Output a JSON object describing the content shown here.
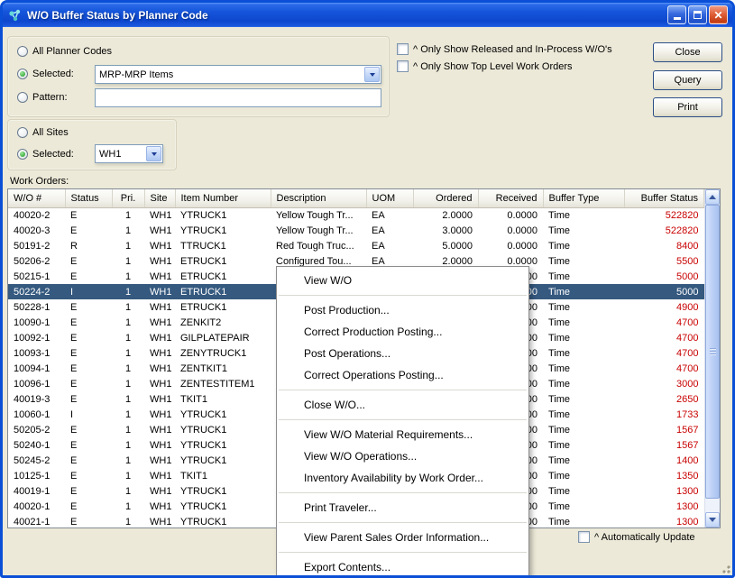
{
  "window": {
    "title": "W/O Buffer Status by Planner Code"
  },
  "planner_group": {
    "all_label": "All Planner Codes",
    "selected_label": "Selected:",
    "selected_value": "MRP-MRP Items",
    "pattern_label": "Pattern:",
    "pattern_value": "",
    "choice": "selected"
  },
  "filters": {
    "released_label": "^ Only Show Released and In-Process W/O's",
    "released_checked": false,
    "toplevel_label": "^ Only Show Top Level Work Orders",
    "toplevel_checked": false
  },
  "actions": {
    "close": "Close",
    "query": "Query",
    "print": "Print"
  },
  "sites_group": {
    "all_label": "All Sites",
    "selected_label": "Selected:",
    "selected_value": "WH1",
    "choice": "selected"
  },
  "work_orders": {
    "label": "Work Orders:",
    "columns": [
      {
        "key": "wo",
        "label": "W/O #",
        "align": "left"
      },
      {
        "key": "status",
        "label": "Status",
        "align": "left"
      },
      {
        "key": "pri",
        "label": "Pri.",
        "align": "center"
      },
      {
        "key": "site",
        "label": "Site",
        "align": "left"
      },
      {
        "key": "item",
        "label": "Item Number",
        "align": "left"
      },
      {
        "key": "desc",
        "label": "Description",
        "align": "left"
      },
      {
        "key": "uom",
        "label": "UOM",
        "align": "left"
      },
      {
        "key": "ordered",
        "label": "Ordered",
        "align": "right"
      },
      {
        "key": "received",
        "label": "Received",
        "align": "right"
      },
      {
        "key": "buffer_type",
        "label": "Buffer Type",
        "align": "left"
      },
      {
        "key": "buffer_status",
        "label": "Buffer Status",
        "align": "right"
      }
    ],
    "rows": [
      {
        "wo": "40020-2",
        "status": "E",
        "pri": "1",
        "site": "WH1",
        "item": "YTRUCK1",
        "desc": "Yellow Tough Tr...",
        "uom": "EA",
        "ordered": "2.0000",
        "received": "0.0000",
        "buffer_type": "Time",
        "buffer_status": "522820",
        "selected": false
      },
      {
        "wo": "40020-3",
        "status": "E",
        "pri": "1",
        "site": "WH1",
        "item": "YTRUCK1",
        "desc": "Yellow Tough Tr...",
        "uom": "EA",
        "ordered": "3.0000",
        "received": "0.0000",
        "buffer_type": "Time",
        "buffer_status": "522820",
        "selected": false
      },
      {
        "wo": "50191-2",
        "status": "R",
        "pri": "1",
        "site": "WH1",
        "item": "TTRUCK1",
        "desc": "Red Tough Truc...",
        "uom": "EA",
        "ordered": "5.0000",
        "received": "0.0000",
        "buffer_type": "Time",
        "buffer_status": "8400",
        "selected": false
      },
      {
        "wo": "50206-2",
        "status": "E",
        "pri": "1",
        "site": "WH1",
        "item": "ETRUCK1",
        "desc": "Configured Tou...",
        "uom": "EA",
        "ordered": "2.0000",
        "received": "0.0000",
        "buffer_type": "Time",
        "buffer_status": "5500",
        "selected": false
      },
      {
        "wo": "50215-1",
        "status": "E",
        "pri": "1",
        "site": "WH1",
        "item": "ETRUCK1",
        "desc": "",
        "uom": "",
        "ordered": "",
        "received": "0.0000",
        "buffer_type": "Time",
        "buffer_status": "5000",
        "selected": false
      },
      {
        "wo": "50224-2",
        "status": "I",
        "pri": "1",
        "site": "WH1",
        "item": "ETRUCK1",
        "desc": "",
        "uom": "",
        "ordered": "",
        "received": "0.0000",
        "buffer_type": "Time",
        "buffer_status": "5000",
        "selected": true
      },
      {
        "wo": "50228-1",
        "status": "E",
        "pri": "1",
        "site": "WH1",
        "item": "ETRUCK1",
        "desc": "",
        "uom": "",
        "ordered": "",
        "received": "0.0000",
        "buffer_type": "Time",
        "buffer_status": "4900",
        "selected": false
      },
      {
        "wo": "10090-1",
        "status": "E",
        "pri": "1",
        "site": "WH1",
        "item": "ZENKIT2",
        "desc": "",
        "uom": "",
        "ordered": "",
        "received": "0.0000",
        "buffer_type": "Time",
        "buffer_status": "4700",
        "selected": false
      },
      {
        "wo": "10092-1",
        "status": "E",
        "pri": "1",
        "site": "WH1",
        "item": "GILPLATEPAIR",
        "desc": "",
        "uom": "",
        "ordered": "",
        "received": "0.0000",
        "buffer_type": "Time",
        "buffer_status": "4700",
        "selected": false
      },
      {
        "wo": "10093-1",
        "status": "E",
        "pri": "1",
        "site": "WH1",
        "item": "ZENYTRUCK1",
        "desc": "",
        "uom": "",
        "ordered": "",
        "received": "0.0000",
        "buffer_type": "Time",
        "buffer_status": "4700",
        "selected": false
      },
      {
        "wo": "10094-1",
        "status": "E",
        "pri": "1",
        "site": "WH1",
        "item": "ZENTKIT1",
        "desc": "",
        "uom": "",
        "ordered": "",
        "received": "0.0000",
        "buffer_type": "Time",
        "buffer_status": "4700",
        "selected": false
      },
      {
        "wo": "10096-1",
        "status": "E",
        "pri": "1",
        "site": "WH1",
        "item": "ZENTESTITEM1",
        "desc": "",
        "uom": "",
        "ordered": "",
        "received": "0.0000",
        "buffer_type": "Time",
        "buffer_status": "3000",
        "selected": false
      },
      {
        "wo": "40019-3",
        "status": "E",
        "pri": "1",
        "site": "WH1",
        "item": "TKIT1",
        "desc": "",
        "uom": "",
        "ordered": "",
        "received": "0.0000",
        "buffer_type": "Time",
        "buffer_status": "2650",
        "selected": false
      },
      {
        "wo": "10060-1",
        "status": "I",
        "pri": "1",
        "site": "WH1",
        "item": "YTRUCK1",
        "desc": "",
        "uom": "",
        "ordered": "",
        "received": "0.0000",
        "buffer_type": "Time",
        "buffer_status": "1733",
        "selected": false
      },
      {
        "wo": "50205-2",
        "status": "E",
        "pri": "1",
        "site": "WH1",
        "item": "YTRUCK1",
        "desc": "",
        "uom": "",
        "ordered": "",
        "received": "0.0000",
        "buffer_type": "Time",
        "buffer_status": "1567",
        "selected": false
      },
      {
        "wo": "50240-1",
        "status": "E",
        "pri": "1",
        "site": "WH1",
        "item": "YTRUCK1",
        "desc": "",
        "uom": "",
        "ordered": "",
        "received": "0.0000",
        "buffer_type": "Time",
        "buffer_status": "1567",
        "selected": false
      },
      {
        "wo": "50245-2",
        "status": "E",
        "pri": "1",
        "site": "WH1",
        "item": "YTRUCK1",
        "desc": "",
        "uom": "",
        "ordered": "",
        "received": "0.0000",
        "buffer_type": "Time",
        "buffer_status": "1400",
        "selected": false
      },
      {
        "wo": "10125-1",
        "status": "E",
        "pri": "1",
        "site": "WH1",
        "item": "TKIT1",
        "desc": "",
        "uom": "",
        "ordered": "",
        "received": "0.0000",
        "buffer_type": "Time",
        "buffer_status": "1350",
        "selected": false
      },
      {
        "wo": "40019-1",
        "status": "E",
        "pri": "1",
        "site": "WH1",
        "item": "YTRUCK1",
        "desc": "",
        "uom": "",
        "ordered": "",
        "received": "0.0000",
        "buffer_type": "Time",
        "buffer_status": "1300",
        "selected": false
      },
      {
        "wo": "40020-1",
        "status": "E",
        "pri": "1",
        "site": "WH1",
        "item": "YTRUCK1",
        "desc": "",
        "uom": "",
        "ordered": "",
        "received": "0.0000",
        "buffer_type": "Time",
        "buffer_status": "1300",
        "selected": false
      },
      {
        "wo": "40021-1",
        "status": "E",
        "pri": "1",
        "site": "WH1",
        "item": "YTRUCK1",
        "desc": "",
        "uom": "",
        "ordered": "",
        "received": "0.0000",
        "buffer_type": "Time",
        "buffer_status": "1300",
        "selected": false
      }
    ]
  },
  "context_menu": {
    "items": [
      "View W/O",
      "---",
      "Post Production...",
      "Correct Production Posting...",
      "Post Operations...",
      "Correct Operations Posting...",
      "---",
      "Close W/O...",
      "---",
      "View W/O Material Requirements...",
      "View W/O Operations...",
      "Inventory Availability by Work Order...",
      "---",
      "Print Traveler...",
      "---",
      "View Parent Sales Order Information...",
      "---",
      "Export Contents..."
    ]
  },
  "footer": {
    "auto_update_label": "^ Automatically Update",
    "auto_update_checked": false
  },
  "colors": {
    "window_border": "#0A4FD6",
    "selection_bg": "#35597F",
    "alert_red": "#C80000",
    "selected_site_green": "#5CCB5C"
  }
}
